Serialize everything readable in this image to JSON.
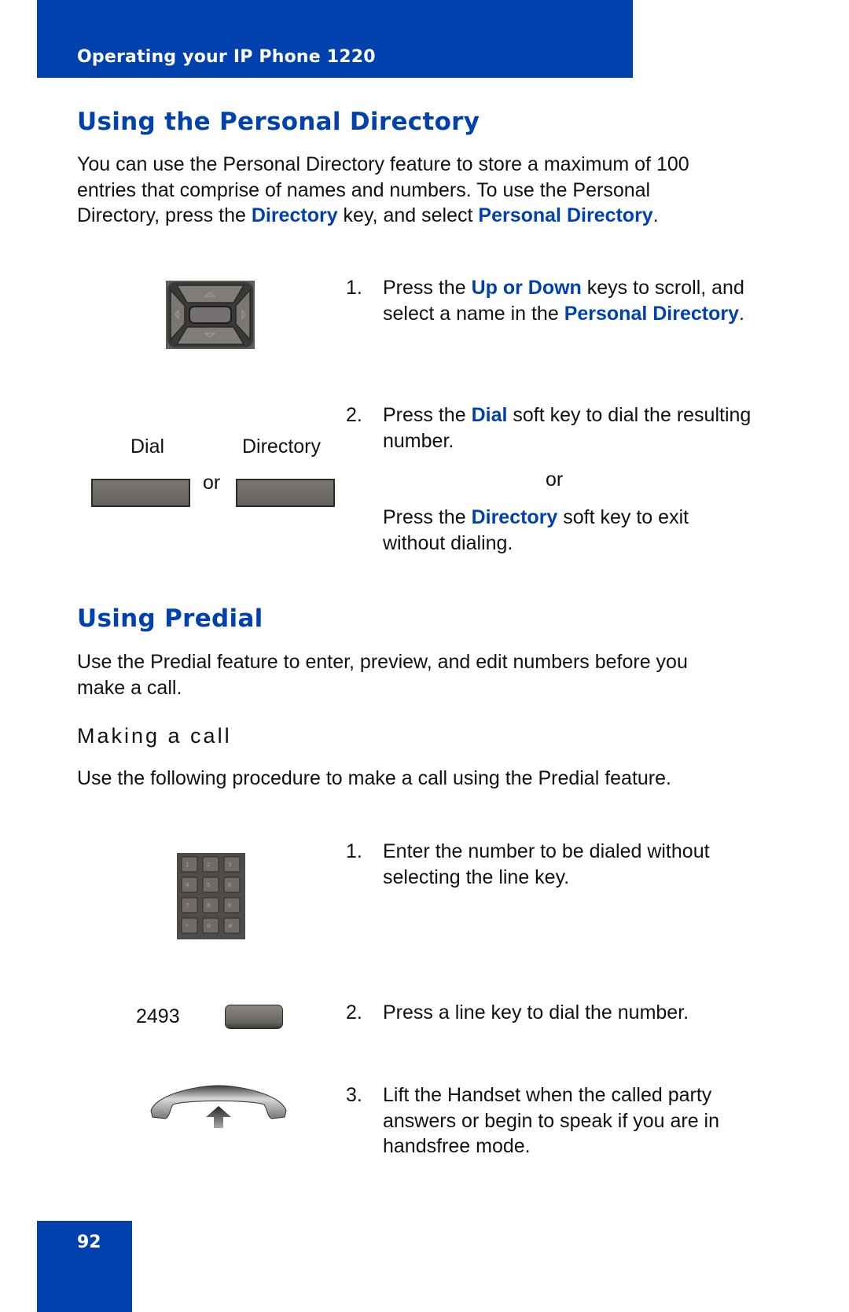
{
  "header": {
    "title": "Operating your IP Phone 1220"
  },
  "section1": {
    "heading": "Using the Personal Directory",
    "intro": {
      "line1": "You can use the Personal Directory feature to store a maximum of 100",
      "line2": "entries that comprise of names and numbers. To use the Personal",
      "line3_a": "Directory, press the ",
      "line3_hl1": "Directory",
      "line3_b": " key, and select ",
      "line3_hl2": "Personal Directory",
      "line3_c": "."
    },
    "step1": {
      "num": "1.",
      "a": "Press the ",
      "hl1": "Up or Down",
      "b": " keys to scroll, and select a name in the ",
      "hl2": "Personal Directory",
      "c": "."
    },
    "step2": {
      "num": "2.",
      "a": "Press the ",
      "hl1": "Dial",
      "b": " soft key to dial the resulting number.",
      "or": "or",
      "c": "Press the ",
      "hl2": "Directory",
      "d": " soft key to exit without dialing."
    },
    "softkeys": {
      "dial_label": "Dial",
      "directory_label": "Directory",
      "or": "or"
    }
  },
  "section2": {
    "heading": "Using Predial",
    "intro": {
      "line1": "Use the Predial feature to enter, preview, and edit numbers before you",
      "line2": "make a call."
    },
    "subheading": "Making a call",
    "procedure_intro": "Use the following procedure to make a call using the Predial feature.",
    "step1": {
      "num": "1.",
      "text": "Enter the number to be dialed without selecting the line key."
    },
    "step2": {
      "num": "2.",
      "text": "Press a line key to dial the number."
    },
    "step3": {
      "num": "3.",
      "text": "Lift the Handset when the called party answers or begin to speak if you are in handsfree mode."
    },
    "line_key_number": "2493"
  },
  "footer": {
    "page_number": "92"
  },
  "colors": {
    "brand_blue": "#0041ad"
  }
}
